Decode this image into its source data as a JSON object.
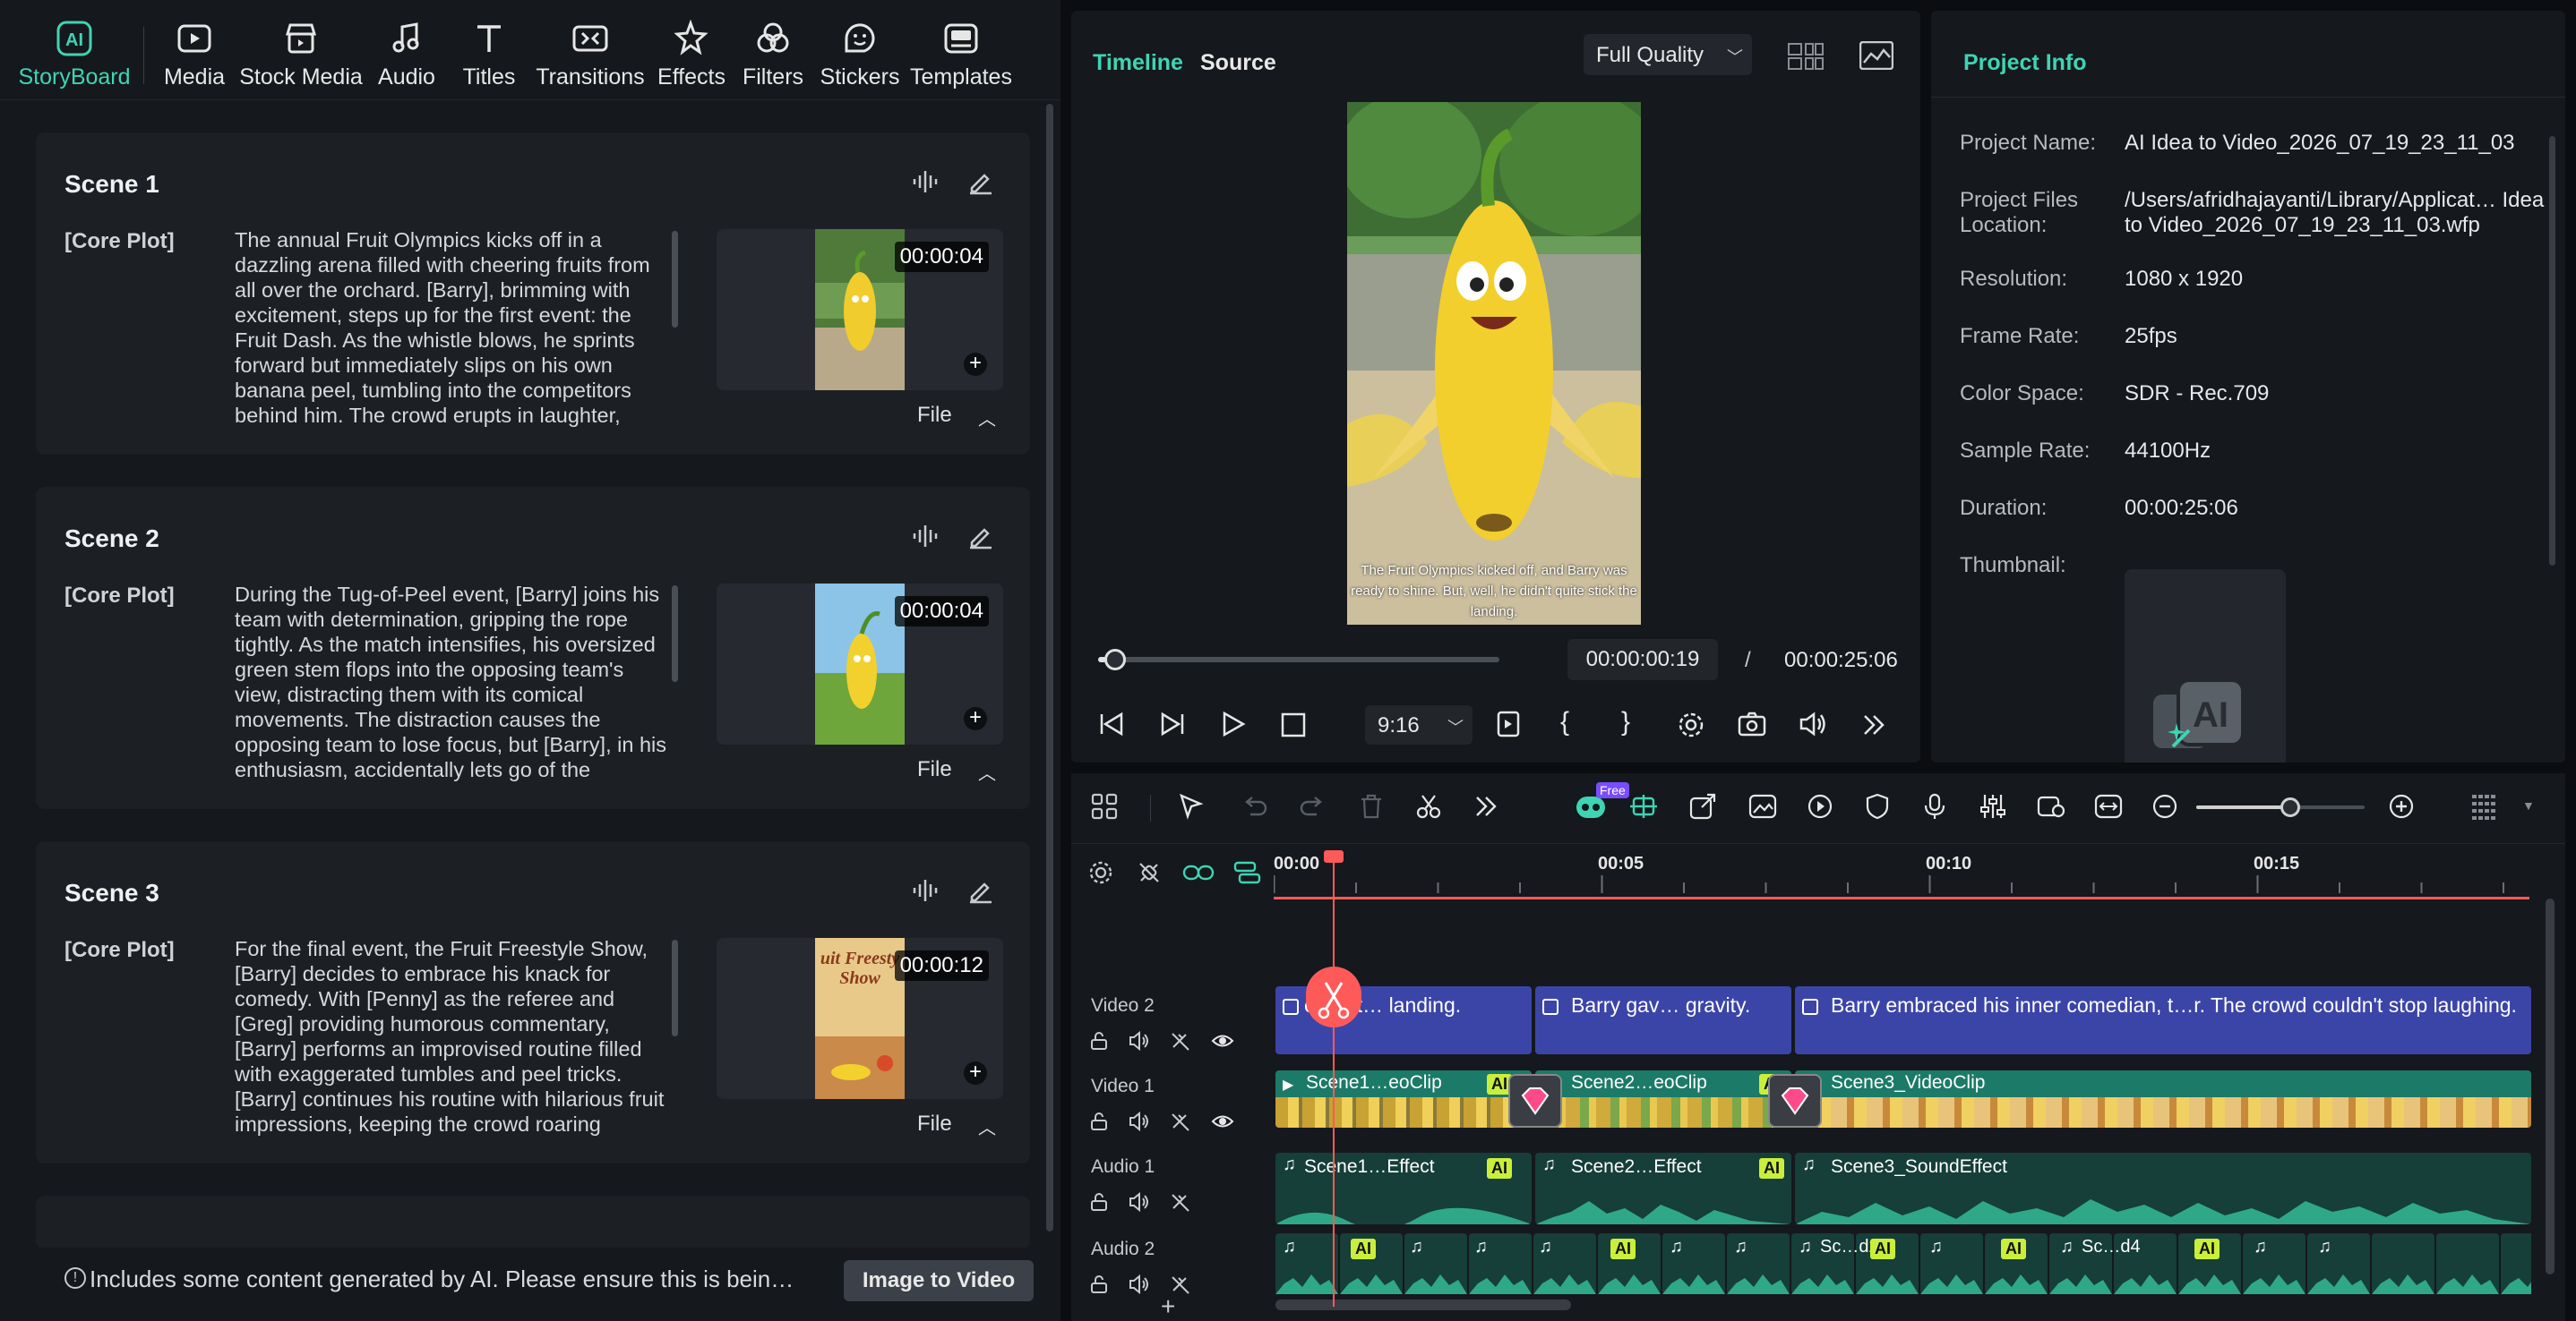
{
  "toolbar": {
    "items": [
      {
        "label": "StoryBoard",
        "icon": "storyboard-icon"
      },
      {
        "label": "Media",
        "icon": "media-icon"
      },
      {
        "label": "Stock Media",
        "icon": "stock-media-icon"
      },
      {
        "label": "Audio",
        "icon": "audio-icon"
      },
      {
        "label": "Titles",
        "icon": "titles-icon"
      },
      {
        "label": "Transitions",
        "icon": "transitions-icon"
      },
      {
        "label": "Effects",
        "icon": "effects-icon"
      },
      {
        "label": "Filters",
        "icon": "filters-icon"
      },
      {
        "label": "Stickers",
        "icon": "stickers-icon"
      },
      {
        "label": "Templates",
        "icon": "templates-icon"
      }
    ],
    "active_color": "#3fd4b4"
  },
  "scenes": [
    {
      "title": "Scene 1",
      "tag": "[Core Plot]",
      "text": "The annual Fruit Olympics kicks off in a dazzling arena filled with cheering fruits from all over the orchard. [Barry], brimming with excitement, steps up for the first event: the Fruit Dash. As the whistle blows, he sprints forward but immediately slips on his own banana peel, tumbling into the competitors behind him. The crowd erupts in laughter,",
      "duration": "00:00:04",
      "file": "File"
    },
    {
      "title": "Scene 2",
      "tag": "[Core Plot]",
      "text": "During the Tug-of-Peel event, [Barry] joins his team with determination, gripping the rope tightly. As the match intensifies, his oversized green stem flops into the opposing team's view, distracting them with its comical movements. The distraction causes the opposing team to lose focus, but [Barry], in his enthusiasm, accidentally lets go of the",
      "duration": "00:00:04",
      "file": "File"
    },
    {
      "title": "Scene 3",
      "tag": "[Core Plot]",
      "text": "For the final event, the Fruit Freestyle Show, [Barry] decides to embrace his knack for comedy. With [Penny] as the referee and [Greg] providing humorous commentary, [Barry] performs an improvised routine filled with exaggerated tumbles and peel tricks. [Barry] continues his routine with hilarious fruit impressions, keeping the crowd roaring",
      "duration": "00:00:12",
      "file": "File",
      "thumb_text": "uit Freesty Show"
    }
  ],
  "footer": {
    "notice": "Includes some content generated by AI. Please ensure this is bein…",
    "button": "Image to Video"
  },
  "viewer": {
    "tab_timeline": "Timeline",
    "tab_source": "Source",
    "quality": "Full Quality",
    "subtitle": "The Fruit Olympics kicked off, and Barry was ready to shine. But, well, he didn't quite stick the landing.",
    "current_time": "00:00:00:19",
    "separator": "/",
    "total_time": "00:00:25:06",
    "aspect": "9:16",
    "progress": 0.02
  },
  "info": {
    "title": "Project Info",
    "rows": [
      {
        "label": "Project Name:",
        "value": "AI Idea to Video_2026_07_19_23_11_03"
      },
      {
        "label": "Project Files Location:",
        "value": "/Users/afridhajayanti/Library/Applicat… Idea to Video_2026_07_19_23_11_03.wfp"
      },
      {
        "label": "Resolution:",
        "value": "1080 x 1920"
      },
      {
        "label": "Frame Rate:",
        "value": "25fps"
      },
      {
        "label": "Color Space:",
        "value": "SDR - Rec.709"
      },
      {
        "label": "Sample Rate:",
        "value": "44100Hz"
      },
      {
        "label": "Duration:",
        "value": "00:00:25:06"
      },
      {
        "label": "Thumbnail:",
        "value": ""
      }
    ]
  },
  "timeline": {
    "free_badge": "Free",
    "ruler": [
      "00:00",
      "00:05",
      "00:10",
      "00:15"
    ],
    "tracks": {
      "video2": "Video 2",
      "video1": "Video 1",
      "audio1": "Audio 1",
      "audio2": "Audio 2"
    },
    "video2_clips": [
      "e Fruit… landing.",
      "Barry gav… gravity.",
      "Barry embraced his inner comedian, t…r. The crowd couldn't stop laughing."
    ],
    "video1_clips": [
      "Scene1…eoClip",
      "Scene2…eoClip",
      "Scene3_VideoClip"
    ],
    "audio1_clips": [
      "Scene1…Effect",
      "Scene2…Effect",
      "Scene3_SoundEffect"
    ],
    "audio2_labels": [
      "Sc…d2",
      "Sc…d4"
    ],
    "ai_badge": "AI",
    "colors": {
      "title_track": "#3b45a8",
      "video_track": "#1c7a68",
      "audio_track": "#1a5e52",
      "playhead": "#ff5a5a",
      "accent": "#3fd4b4"
    }
  }
}
